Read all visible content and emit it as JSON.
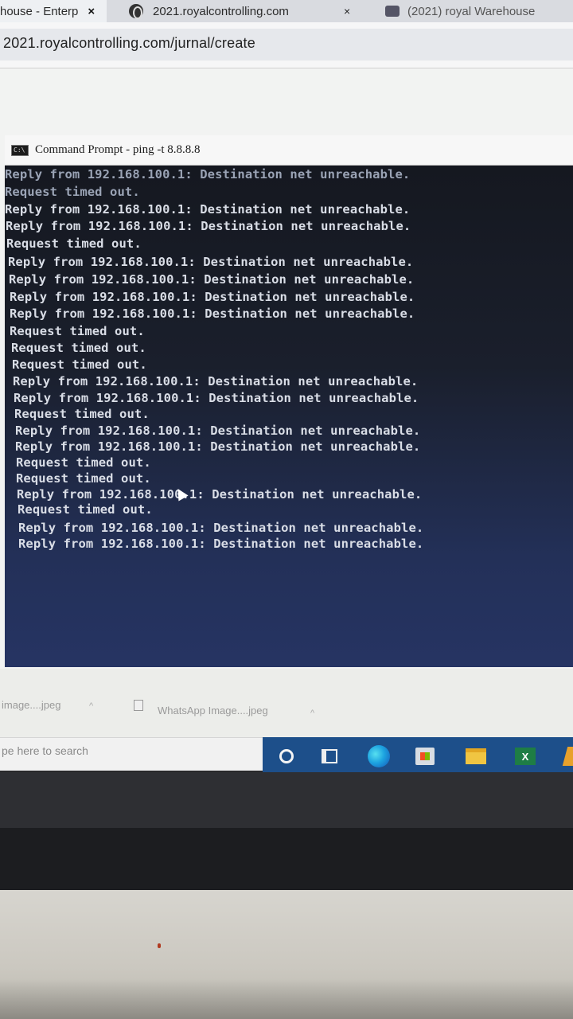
{
  "browser": {
    "tabs": [
      {
        "label": "house - Enterp"
      },
      {
        "label": "2021.royalcontrolling.com"
      },
      {
        "label": "(2021) royal Warehouse"
      }
    ],
    "close_glyph": "×",
    "address": "2021.royalcontrolling.com/jurnal/create"
  },
  "cmd": {
    "title": "Command Prompt - ping  -t 8.8.8.8",
    "icon_text": "C:\\",
    "lines": [
      "Reply from 192.168.100.1: Destination net unreachable.",
      "Request timed out.",
      "Reply from 192.168.100.1: Destination net unreachable.",
      "Reply from 192.168.100.1: Destination net unreachable.",
      "Request timed out.",
      "Reply from 192.168.100.1: Destination net unreachable.",
      "Reply from 192.168.100.1: Destination net unreachable.",
      "Reply from 192.168.100.1: Destination net unreachable.",
      "Reply from 192.168.100.1: Destination net unreachable.",
      "Request timed out.",
      "Request timed out.",
      "Request timed out.",
      "Reply from 192.168.100.1: Destination net unreachable.",
      "Reply from 192.168.100.1: Destination net unreachable.",
      "Request timed out.",
      "Reply from 192.168.100.1: Destination net unreachable.",
      "Reply from 192.168.100.1: Destination net unreachable.",
      "Request timed out.",
      "Request timed out.",
      "Reply from 192.168.100.1: Destination net unreachable.",
      "Request timed out.",
      "Reply from 192.168.100.1: Destination net unreachable.",
      "Reply from 192.168.100.1: Destination net unreachable."
    ]
  },
  "downloads": [
    {
      "label": "image....jpeg",
      "chevron": "^"
    },
    {
      "label": "WhatsApp Image....jpeg",
      "chevron": "^"
    }
  ],
  "taskbar": {
    "search_placeholder": "pe here to search",
    "excel_label": "X"
  },
  "icons": {
    "cortana": "cortana-icon",
    "task_view": "task-view-icon",
    "edge": "edge-icon",
    "store": "store-icon",
    "explorer": "file-explorer-icon",
    "excel": "excel-icon"
  },
  "colors": {
    "console_bg_top": "#151820",
    "console_bg_bottom": "#263463",
    "console_text": "#d9dde6",
    "taskbar": "#1d4f8a"
  }
}
